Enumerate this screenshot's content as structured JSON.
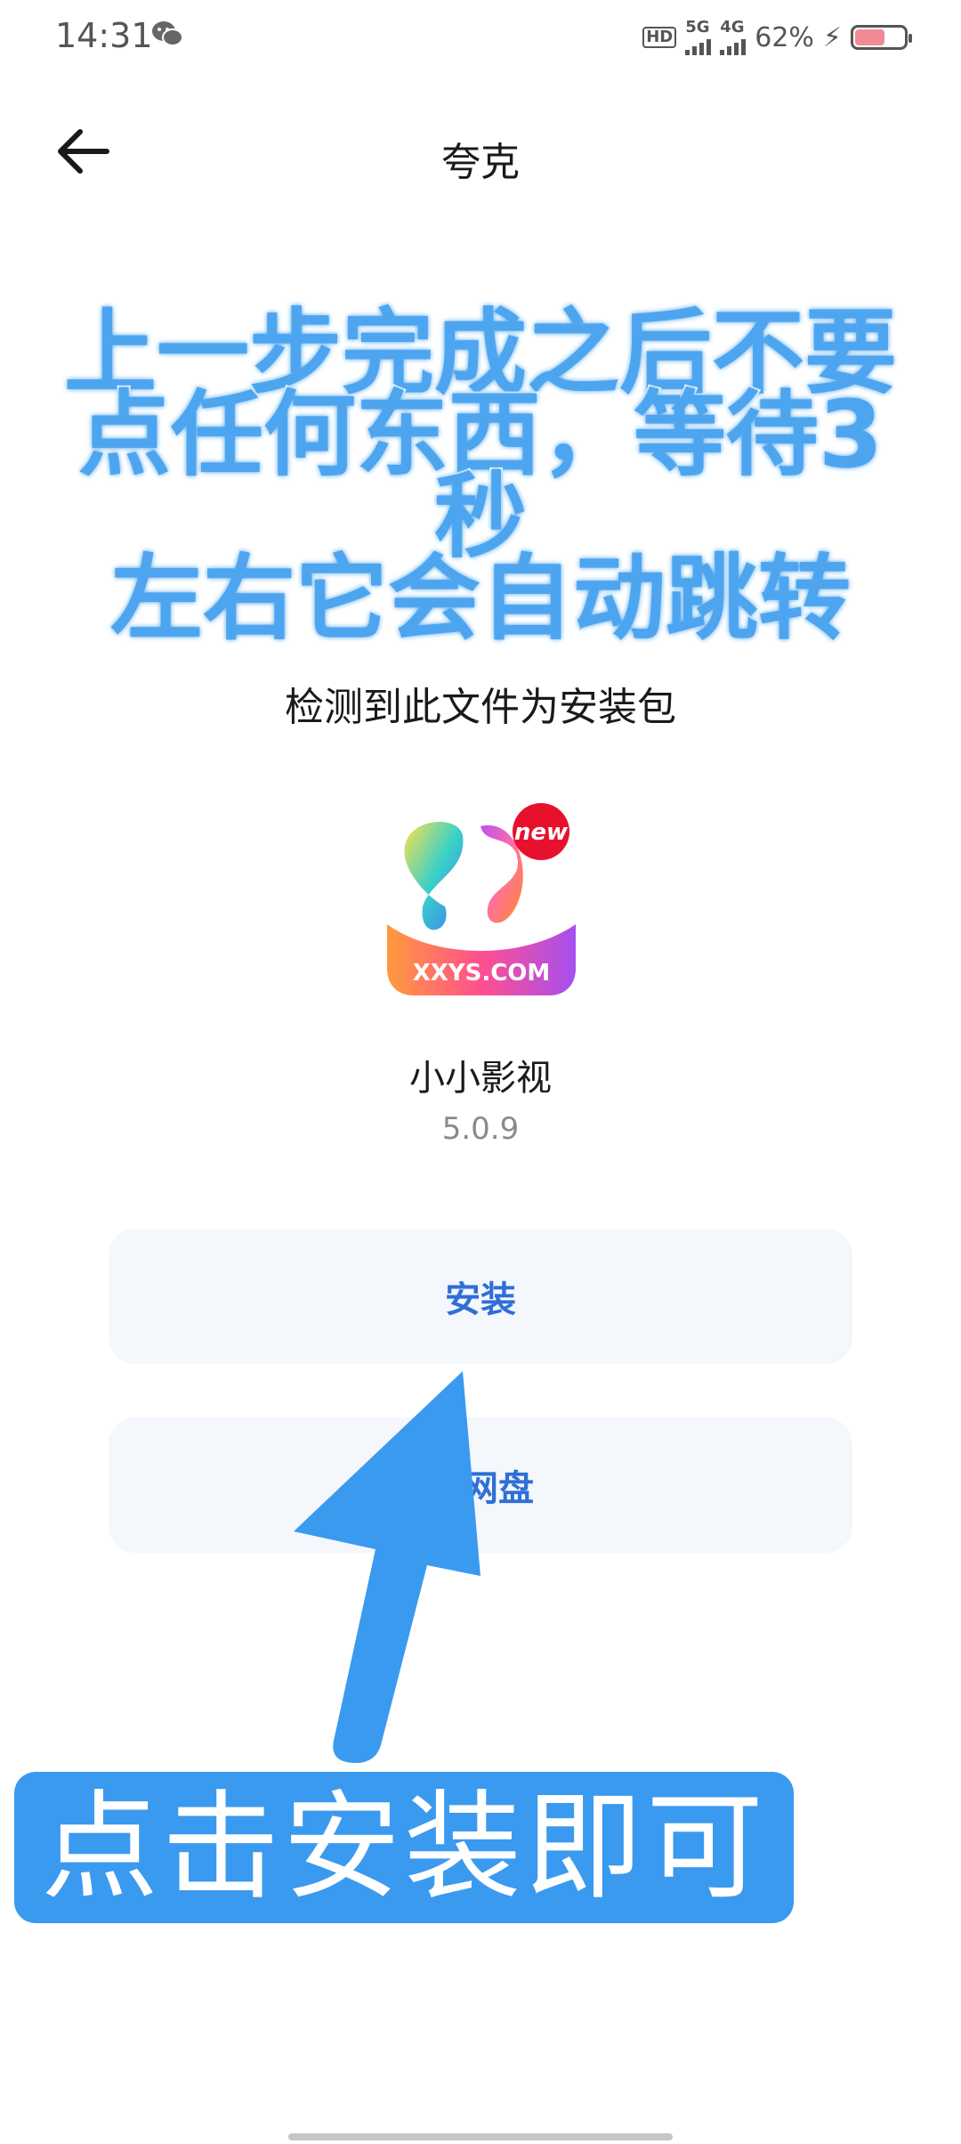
{
  "status_bar": {
    "time": "14:31",
    "hd_label": "HD",
    "sim1_label": "5G",
    "sim2_label": "4G",
    "battery_percent": "62%",
    "battery_level": 0.62,
    "battery_color": "#f08a95"
  },
  "header": {
    "title": "夸克"
  },
  "overlay": {
    "line1": "上一步完成之后不要",
    "line2": "点任何东西，等待3秒",
    "line3": "左右它会自动跳转",
    "color": "#4ea5ef"
  },
  "main": {
    "detect_text": "检测到此文件为安装包",
    "app_icon_text": "XXYS.COM",
    "app_icon_badge": "new",
    "app_name": "小小影视",
    "app_version": "5.0.9",
    "install_label": "安装",
    "save_label": "存网盘"
  },
  "banner": {
    "text": "点击安装即可",
    "color": "#3a9af0"
  }
}
